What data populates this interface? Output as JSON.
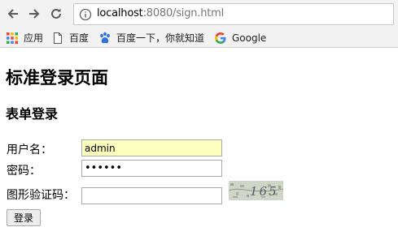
{
  "browser": {
    "url_host": "localhost",
    "url_rest": ":8080/sign.html",
    "bookmarks": [
      {
        "label": "应用",
        "icon": "apps-grid-icon"
      },
      {
        "label": "百度",
        "icon": "page-icon"
      },
      {
        "label": "百度一下，你就知道",
        "icon": "baidu-paw-icon"
      },
      {
        "label": "Google",
        "icon": "google-g-icon"
      }
    ]
  },
  "page": {
    "title": "标准登录页面",
    "form_title": "表单登录",
    "username_label": "用户名：",
    "username_value": "admin",
    "password_label": "密码：",
    "password_value": "••••••",
    "captcha_label": "图形验证码：",
    "captcha_value": "",
    "captcha_text": "165",
    "login_button": "登录"
  },
  "colors": {
    "autofill_bg": "#faffbd",
    "toolbar_bg": "#f2f2f2"
  }
}
